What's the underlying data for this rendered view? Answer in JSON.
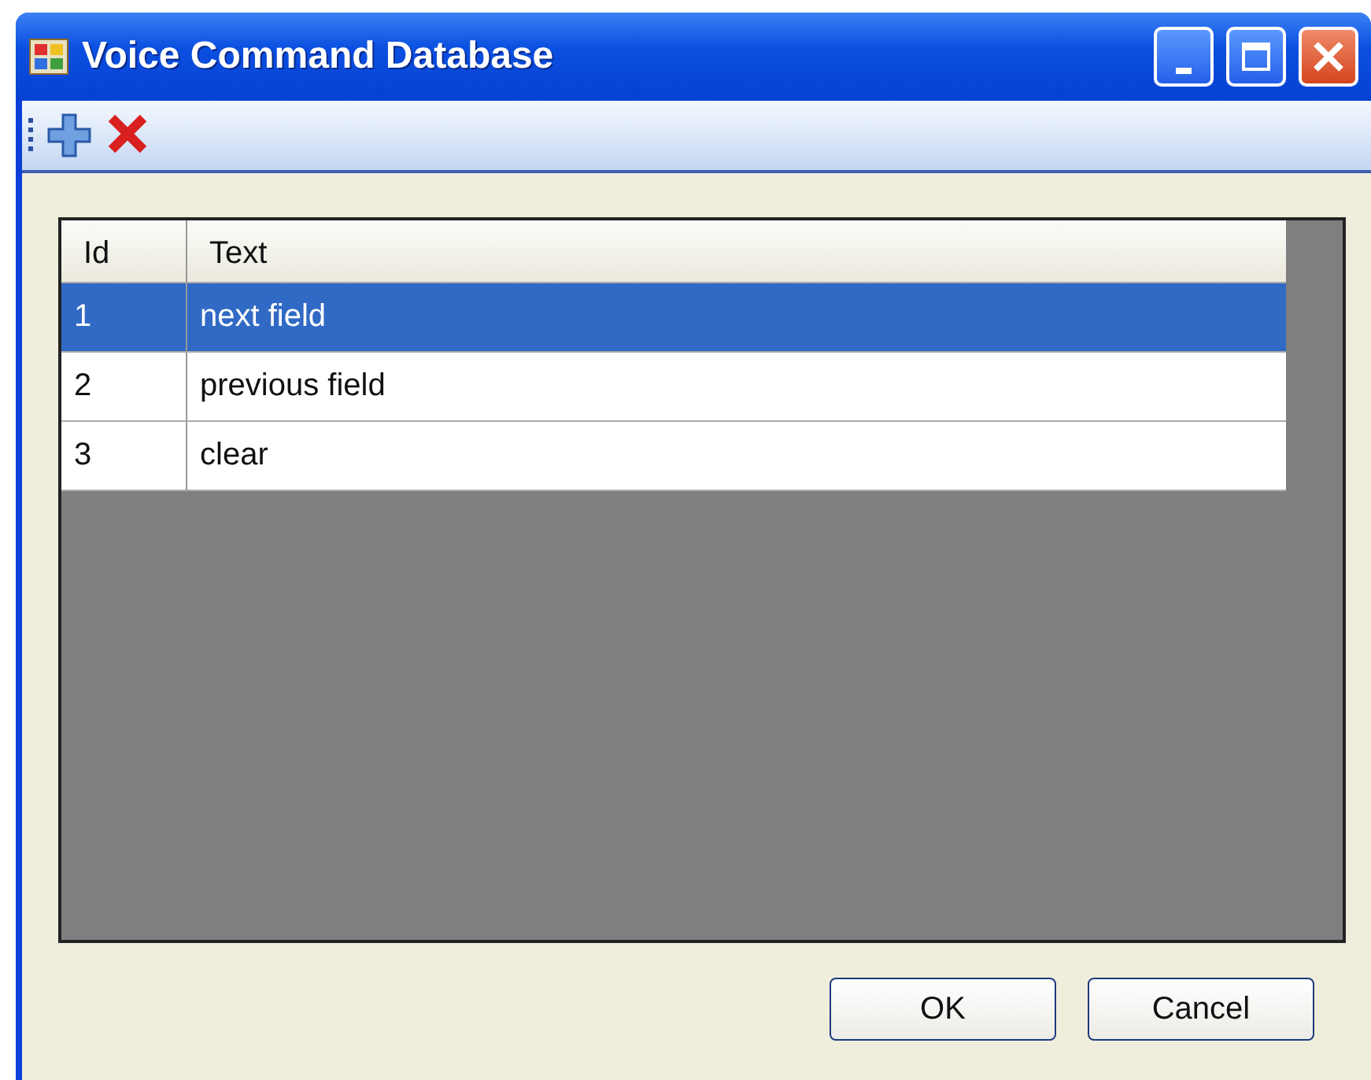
{
  "window": {
    "title": "Voice Command Database"
  },
  "toolbar": {
    "buttons": [
      {
        "kind": "add"
      },
      {
        "kind": "delete"
      }
    ]
  },
  "table": {
    "columns": [
      "Id",
      "Text"
    ],
    "rows": [
      {
        "cells": [
          "1",
          "next field"
        ],
        "selected": true
      },
      {
        "cells": [
          "2",
          "previous field"
        ],
        "selected": false
      },
      {
        "cells": [
          "3",
          "clear"
        ],
        "selected": false
      }
    ]
  },
  "buttons": [
    "OK",
    "Cancel"
  ]
}
